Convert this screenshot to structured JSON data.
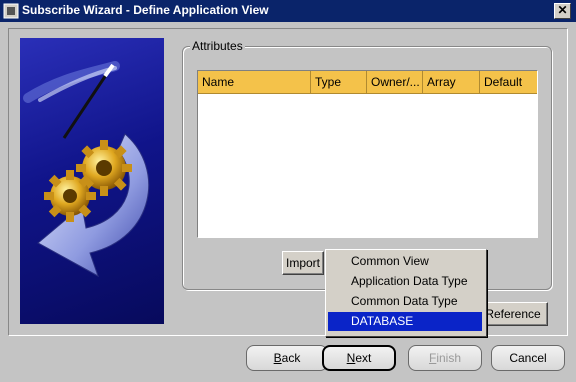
{
  "window": {
    "title": "Subscribe Wizard  - Define Application View",
    "close_glyph": "✕"
  },
  "attributes": {
    "group_label": "Attributes",
    "columns": [
      "Name",
      "Type",
      "Owner/...",
      "Array",
      "Default"
    ],
    "rows": []
  },
  "import_button": "Import",
  "reference_button": "Reference",
  "menu": {
    "items": [
      "Common View",
      "Application Data Type",
      "Common Data Type",
      "DATABASE"
    ],
    "selected": "DATABASE"
  },
  "nav": {
    "back": {
      "mnemonic": "B",
      "rest": "ack"
    },
    "next": {
      "mnemonic": "N",
      "rest": "ext"
    },
    "finish": {
      "mnemonic": "F",
      "rest": "inish"
    },
    "cancel": "Cancel"
  },
  "icons": [
    "app-icon",
    "close-icon",
    "wizard-illustration"
  ]
}
